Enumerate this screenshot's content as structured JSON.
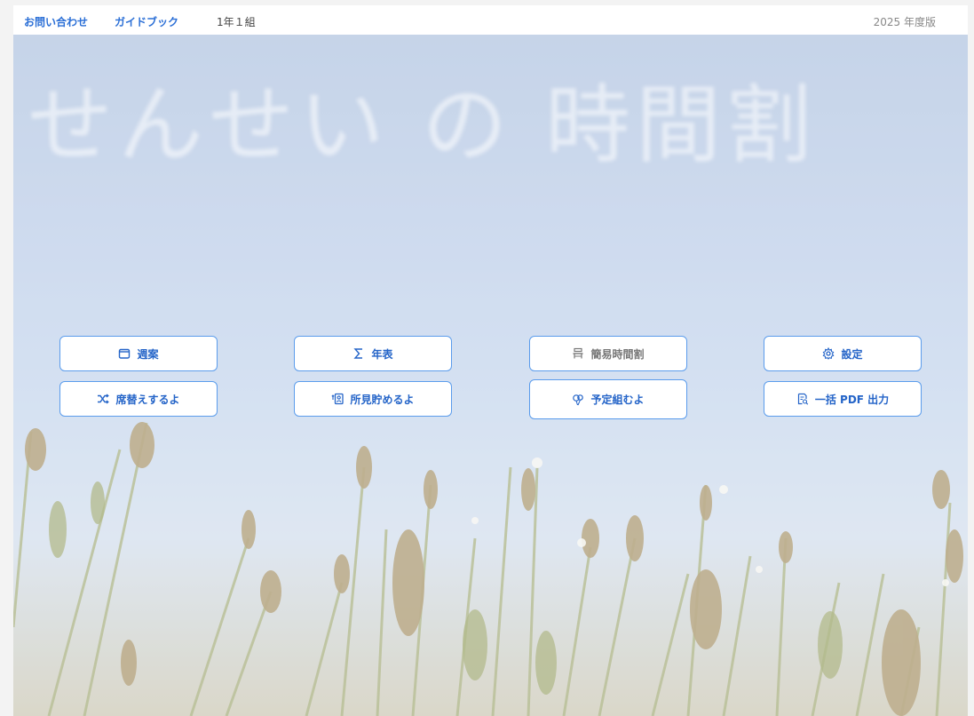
{
  "topbar": {
    "contact_link": "お問い合わせ",
    "guidebook_link": "ガイドブック",
    "class_name": "1年１組",
    "edition": "2025 年度版"
  },
  "title": "せんせい の 時間割",
  "menu": {
    "row1": [
      {
        "label": "週案",
        "icon": "calendar-icon"
      },
      {
        "label": "年表",
        "icon": "sigma-icon"
      },
      {
        "label": "簡易時間割",
        "icon": "desk-icon"
      },
      {
        "label": "設定",
        "icon": "gear-icon"
      }
    ],
    "row2": [
      {
        "label": "席替えするよ",
        "icon": "shuffle-icon"
      },
      {
        "label": "所見貯めるよ",
        "icon": "person-card-icon"
      },
      {
        "label": "予定組むよ",
        "icon": "balloon-icon"
      },
      {
        "label": "一括 PDF 出力",
        "icon": "document-search-icon"
      }
    ]
  },
  "colors": {
    "accent": "#2b6fd6",
    "button_border": "#5b9cec",
    "sky_top": "#a9bedd",
    "sky_bottom": "#cfdcec"
  }
}
